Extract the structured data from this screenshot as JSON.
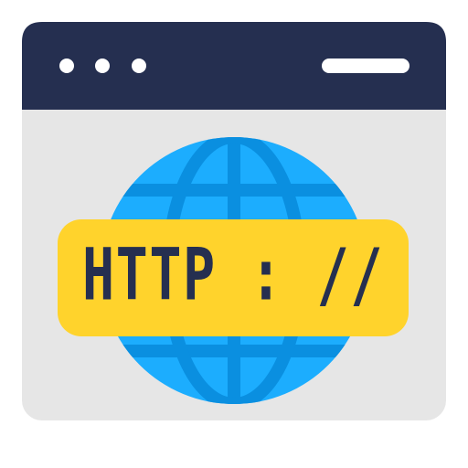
{
  "icon": {
    "name": "http-browser-icon",
    "label": "HTTP : //"
  },
  "colors": {
    "window_frame": "#252F50",
    "window_body": "#E6E6E6",
    "globe_fill": "#1CADFE",
    "globe_lines": "#0A8FE0",
    "label_fill": "#FFD32C",
    "label_text": "#252F50",
    "dots": "#FFFFFF"
  }
}
